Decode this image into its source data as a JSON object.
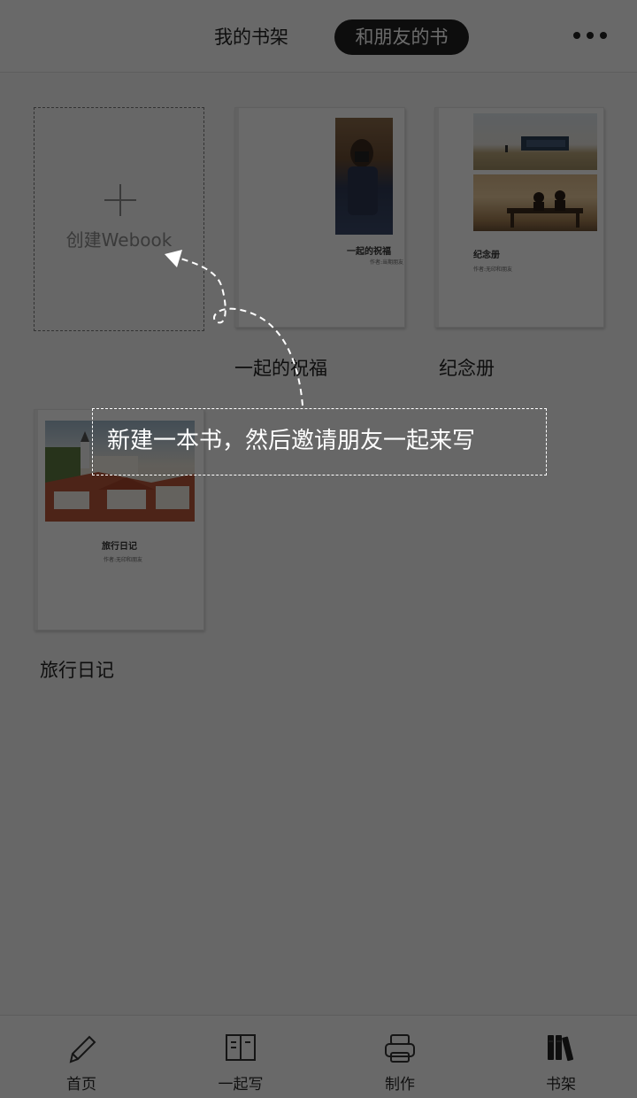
{
  "header": {
    "tabs": [
      "我的书架",
      "和朋友的书"
    ],
    "active_tab": "和朋友的书",
    "more_icon": "more-dots-icon"
  },
  "shelf": {
    "create_label": "创建Webook",
    "books": [
      {
        "name": "一起的祝福",
        "cover_title": "一起的祝福",
        "cover_author": "作者:当期朋友"
      },
      {
        "name": "纪念册",
        "cover_title": "纪念册",
        "cover_author": "作者:无印和朋友"
      },
      {
        "name": "旅行日记",
        "cover_title": "旅行日记",
        "cover_author": "作者:无印和朋友"
      }
    ]
  },
  "guide": {
    "text": "新建一本书，然后邀请朋友一起来写"
  },
  "bottom_nav": {
    "items": [
      {
        "label": "首页",
        "icon": "pencil-icon"
      },
      {
        "label": "一起写",
        "icon": "book-open-icon"
      },
      {
        "label": "制作",
        "icon": "printer-icon"
      },
      {
        "label": "书架",
        "icon": "bookshelf-icon"
      }
    ],
    "active": "书架"
  },
  "colors": {
    "overlay": "#000000",
    "active_tab_bg": "#1f1f1f",
    "background": "#f6f6f6"
  }
}
